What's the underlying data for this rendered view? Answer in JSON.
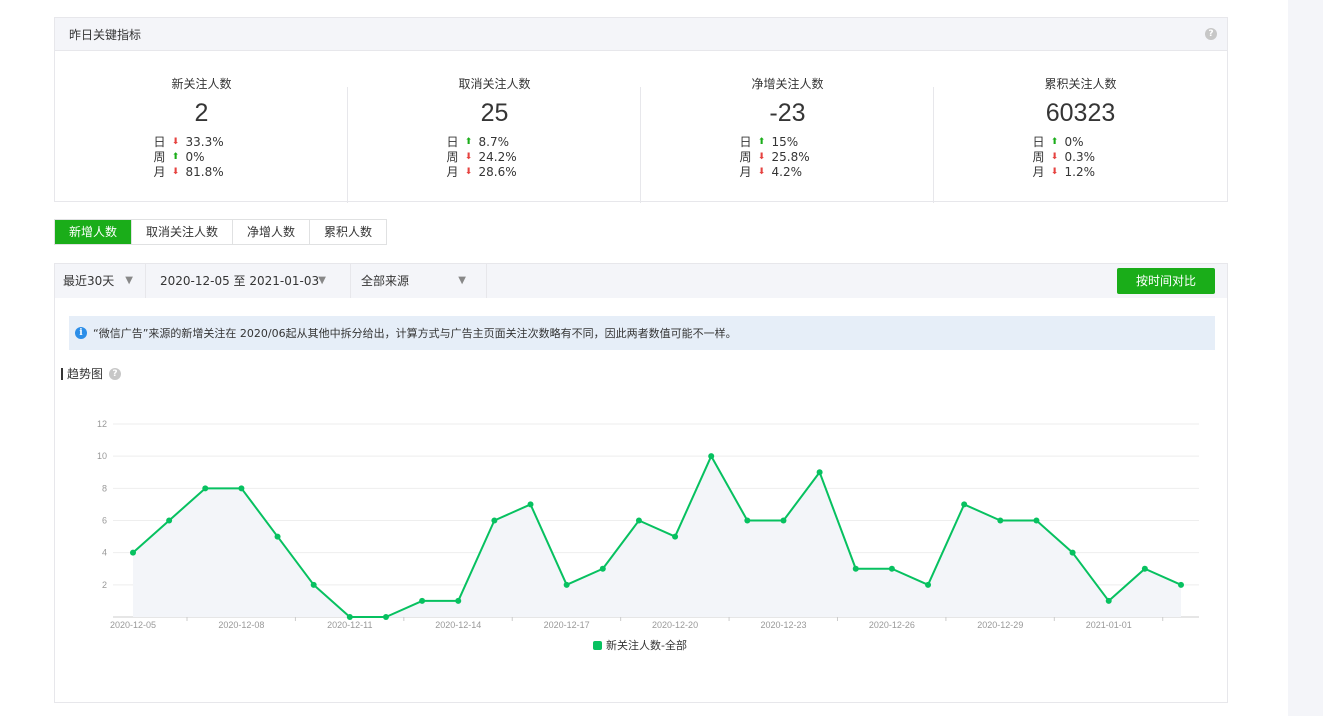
{
  "metrics": {
    "title": "昨日关键指标",
    "help_icon": "question-icon",
    "items": [
      {
        "label": "新关注人数",
        "value": "2",
        "rows": [
          {
            "period": "日",
            "dir": "down",
            "pct": "33.3%"
          },
          {
            "period": "周",
            "dir": "up",
            "pct": "0%"
          },
          {
            "period": "月",
            "dir": "down",
            "pct": "81.8%"
          }
        ]
      },
      {
        "label": "取消关注人数",
        "value": "25",
        "rows": [
          {
            "period": "日",
            "dir": "up",
            "pct": "8.7%"
          },
          {
            "period": "周",
            "dir": "down",
            "pct": "24.2%"
          },
          {
            "period": "月",
            "dir": "down",
            "pct": "28.6%"
          }
        ]
      },
      {
        "label": "净增关注人数",
        "value": "-23",
        "rows": [
          {
            "period": "日",
            "dir": "up",
            "pct": "15%"
          },
          {
            "period": "周",
            "dir": "down",
            "pct": "25.8%"
          },
          {
            "period": "月",
            "dir": "down",
            "pct": "4.2%"
          }
        ]
      },
      {
        "label": "累积关注人数",
        "value": "60323",
        "rows": [
          {
            "period": "日",
            "dir": "up",
            "pct": "0%"
          },
          {
            "period": "周",
            "dir": "down",
            "pct": "0.3%"
          },
          {
            "period": "月",
            "dir": "down",
            "pct": "1.2%"
          }
        ]
      }
    ]
  },
  "tabs": [
    {
      "label": "新增人数",
      "active": true
    },
    {
      "label": "取消关注人数",
      "active": false
    },
    {
      "label": "净增人数",
      "active": false
    },
    {
      "label": "累积人数",
      "active": false
    }
  ],
  "filters": {
    "period": "最近30天",
    "date_range": "2020-12-05 至 2021-01-03",
    "source": "全部来源",
    "compare_button": "按时间对比"
  },
  "notice": {
    "text": "“微信广告”来源的新增关注在 2020/06起从其他中拆分给出，计算方式与广告主页面关注次数略有不同，因此两者数值可能不一样。"
  },
  "trend": {
    "title": "趋势图"
  },
  "colors": {
    "accent": "#1aad19",
    "line": "#07c160",
    "up": "#1aad19",
    "down": "#e64340"
  },
  "chart_data": {
    "type": "line",
    "x": [
      "2020-12-05",
      "2020-12-06",
      "2020-12-07",
      "2020-12-08",
      "2020-12-09",
      "2020-12-10",
      "2020-12-11",
      "2020-12-12",
      "2020-12-13",
      "2020-12-14",
      "2020-12-15",
      "2020-12-16",
      "2020-12-17",
      "2020-12-18",
      "2020-12-19",
      "2020-12-20",
      "2020-12-21",
      "2020-12-22",
      "2020-12-23",
      "2020-12-24",
      "2020-12-25",
      "2020-12-26",
      "2020-12-27",
      "2020-12-28",
      "2020-12-29",
      "2020-12-30",
      "2020-12-31",
      "2021-01-01",
      "2021-01-02",
      "2021-01-03"
    ],
    "series": [
      {
        "name": "新关注人数-全部",
        "values": [
          4,
          6,
          8,
          8,
          5,
          2,
          0,
          0,
          1,
          1,
          6,
          7,
          2,
          3,
          6,
          5,
          10,
          6,
          6,
          9,
          3,
          3,
          2,
          7,
          6,
          6,
          4,
          1,
          3,
          2
        ]
      }
    ],
    "x_tick_labels": [
      "2020-12-05",
      "2020-12-08",
      "2020-12-11",
      "2020-12-14",
      "2020-12-17",
      "2020-12-20",
      "2020-12-23",
      "2020-12-26",
      "2020-12-29",
      "2021-01-01"
    ],
    "y_ticks": [
      2,
      4,
      6,
      8,
      10,
      12
    ],
    "ylim": [
      0,
      12
    ],
    "grid": true,
    "legend": "bottom-center"
  }
}
